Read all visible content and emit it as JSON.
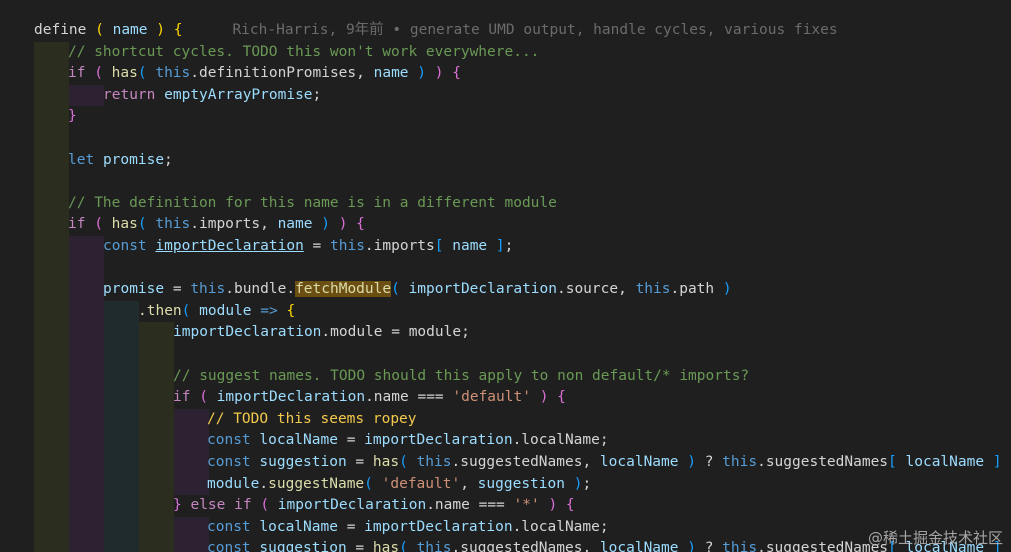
{
  "blame": {
    "text": "Rich-Harris, 9年前 • generate UMD output, handle cycles, various fixes"
  },
  "code": {
    "l1_define": "define",
    "l1_name": "name",
    "l2_comment": "// shortcut cycles. TODO this won't work everywhere...",
    "l3_if": "if",
    "l3_has": "has",
    "l3_this": "this",
    "l3_prop": ".definitionPromises",
    "l3_name": "name",
    "l4_return": "return",
    "l4_val": "emptyArrayPromise",
    "l6_let": "let",
    "l6_promise": "promise",
    "l8_comment": "// The definition for this name is in a different module",
    "l9_if": "if",
    "l9_has": "has",
    "l9_this": "this",
    "l9_prop": ".imports",
    "l9_name": "name",
    "l10_const": "const",
    "l10_var": "importDeclaration",
    "l10_this": "this",
    "l10_prop": ".imports",
    "l10_name": "name",
    "l12_promise": "promise",
    "l12_this": "this",
    "l12_bundle": ".bundle.",
    "l12_fetch": "fetchModule",
    "l12_arg1": "importDeclaration",
    "l12_source": ".source,",
    "l12_this2": "this",
    "l12_path": ".path",
    "l13_then": ".then",
    "l13_module": "module",
    "l14_decl": "importDeclaration",
    "l14_rest": ".module = module;",
    "l16_comment": "// suggest names. TODO should this apply to non default/* imports?",
    "l17_if": "if",
    "l17_decl": "importDeclaration",
    "l17_name": ".name",
    "l17_str": "'default'",
    "l18_todo": "// TODO this seems ropey",
    "l19_const": "const",
    "l19_var": "localName",
    "l19_decl": "importDeclaration",
    "l19_rest": ".localName;",
    "l20_const": "const",
    "l20_var": "suggestion",
    "l20_has": "has",
    "l20_this": "this",
    "l20_prop": ".suggestedNames,",
    "l20_local": "localName",
    "l20_this2": "this",
    "l20_prop2": ".suggestedNames",
    "l20_local2": "localName",
    "l21_module": "module",
    "l21_fn": "suggestName",
    "l21_str": "'default'",
    "l21_sugg": "suggestion",
    "l22_else": "else",
    "l22_if": "if",
    "l22_decl": "importDeclaration",
    "l22_name": ".name",
    "l22_str": "'*'",
    "l23_const": "const",
    "l23_var": "localName",
    "l23_decl": "importDeclaration",
    "l23_rest": ".localName;",
    "l24_const": "const",
    "l24_var": "suggestion",
    "l24_has": "has",
    "l24_this": "this",
    "l24_prop": ".suggestedNames,",
    "l24_local": "localName",
    "l24_this2": "this",
    "l24_prop2": ".suggestedNames",
    "l24_local2": "localName"
  },
  "watermark": "@稀土掘金技术社区",
  "colors": {
    "background": "#1f1f1f",
    "indent_level_1": "#2b2d1f",
    "indent_level_2": "#2d2232",
    "indent_level_3": "#1f2b2c",
    "indent_level_4": "#2b2d1f"
  }
}
